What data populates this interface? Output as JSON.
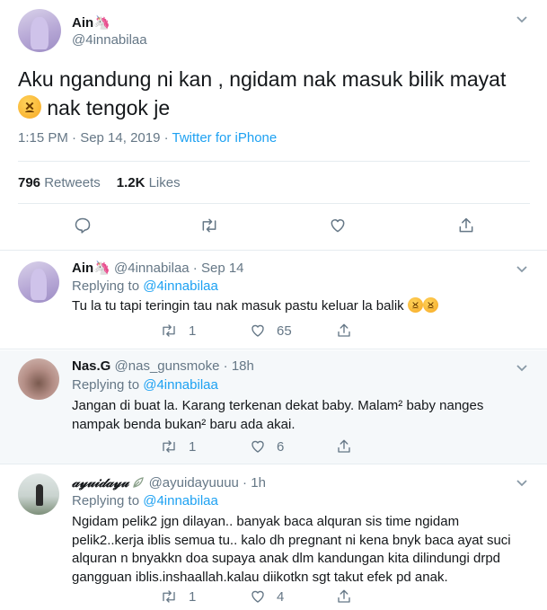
{
  "main_tweet": {
    "author_name": "Ain🦄",
    "author_handle": "@4innabilaa",
    "text_line1": "Aku ngandung ni kan , ngidam nak masuk bilik mayat",
    "text_line2": "nak tengok je",
    "emoji": "persevering-face-emoji",
    "timestamp": "1:15 PM · Sep 14, 2019",
    "separator": " · ",
    "source": "Twitter for iPhone",
    "retweets_count": "796",
    "retweets_label": "Retweets",
    "likes_count": "1.2K",
    "likes_label": "Likes"
  },
  "replies": [
    {
      "author_name": "Ain🦄",
      "author_handle": "@4innabilaa",
      "time": "Sep 14",
      "replying_label": "Replying to",
      "replying_to": "@4innabilaa",
      "text": "Tu la tu tapi teringin tau nak masuk pastu keluar la balik",
      "emoji": "persevering-face-emoji",
      "retweets": "1",
      "likes": "65"
    },
    {
      "author_name": "Nas.G",
      "author_handle": "@nas_gunsmoke",
      "time": "18h",
      "replying_label": "Replying to",
      "replying_to": "@4innabilaa",
      "text_line1": "Jangan di buat la. Karang terkenan dekat baby. Malam² baby nanges",
      "text_line2": "nampak benda bukan² baru ada akai.",
      "retweets": "1",
      "likes": "6"
    },
    {
      "author_name": "𝒶𝓎𝓊𝒾𝒹𝒶𝓎𝓊",
      "author_handle": "@ayuidayuuuu",
      "time": "1h",
      "replying_label": "Replying to",
      "replying_to": "@4innabilaa",
      "text_line1": "Ngidam pelik2 jgn dilayan.. banyak baca alquran sis time ngidam",
      "text_line2": "pelik2..kerja iblis semua tu.. kalo dh pregnant ni kena bnyk baca ayat suci",
      "text_line3": "alquran n bnyakkn doa supaya anak dlm kandungan kita dilindungi drpd",
      "text_line4": "gangguan iblis.inshaallah.kalau diikotkn sgt takut efek pd anak.",
      "retweets": "1",
      "likes": "4"
    }
  ],
  "colors": {
    "accent": "#1da1f2",
    "text": "#14171a",
    "muted": "#657786",
    "border": "#e6ecf0",
    "highlight_bg": "#f5f8fa"
  }
}
